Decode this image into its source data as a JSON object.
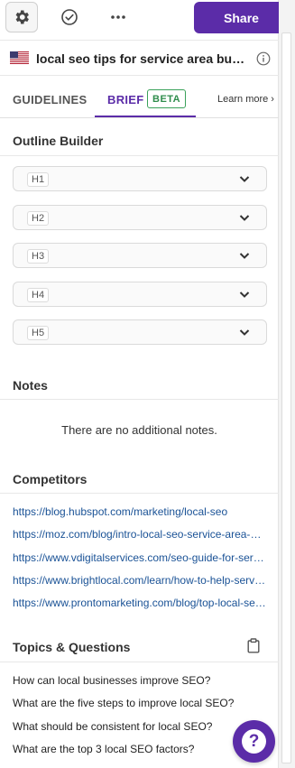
{
  "toolbar": {
    "settings_icon": "gear-icon",
    "status_icon": "check-circle-icon",
    "more_icon": "more-horizontal-icon",
    "share_label": "Share"
  },
  "keyword": {
    "flag": "us-flag-icon",
    "text": "local seo tips for service area businesses",
    "info_icon": "info-icon"
  },
  "tabs": {
    "guidelines_label": "GUIDELINES",
    "brief_label": "BRIEF",
    "beta_label": "BETA",
    "learn_more_label": "Learn more ›",
    "active": "BRIEF"
  },
  "outline": {
    "title": "Outline Builder",
    "items": [
      {
        "label": "H1"
      },
      {
        "label": "H2"
      },
      {
        "label": "H3"
      },
      {
        "label": "H4"
      },
      {
        "label": "H5"
      }
    ]
  },
  "notes": {
    "title": "Notes",
    "empty_text": "There are no additional notes."
  },
  "competitors": {
    "title": "Competitors",
    "links": [
      "https://blog.hubspot.com/marketing/local-seo",
      "https://moz.com/blog/intro-local-seo-service-area-businesses",
      "https://www.vdigitalservices.com/seo-guide-for-service-area-businesses",
      "https://www.brightlocal.com/learn/how-to-help-service-area-businesses",
      "https://www.prontomarketing.com/blog/top-local-seo-tips"
    ]
  },
  "topics": {
    "title": "Topics & Questions",
    "copy_icon": "clipboard-icon",
    "questions": [
      "How can local businesses improve SEO?",
      "What are the five steps to improve local SEO?",
      "What should be consistent for local SEO?",
      "What are the top 3 local SEO factors?"
    ]
  },
  "help": {
    "icon": "help-question-icon",
    "glyph": "?"
  },
  "colors": {
    "accent": "#5b2ca8",
    "beta": "#3aa15a",
    "link": "#1a5296"
  }
}
